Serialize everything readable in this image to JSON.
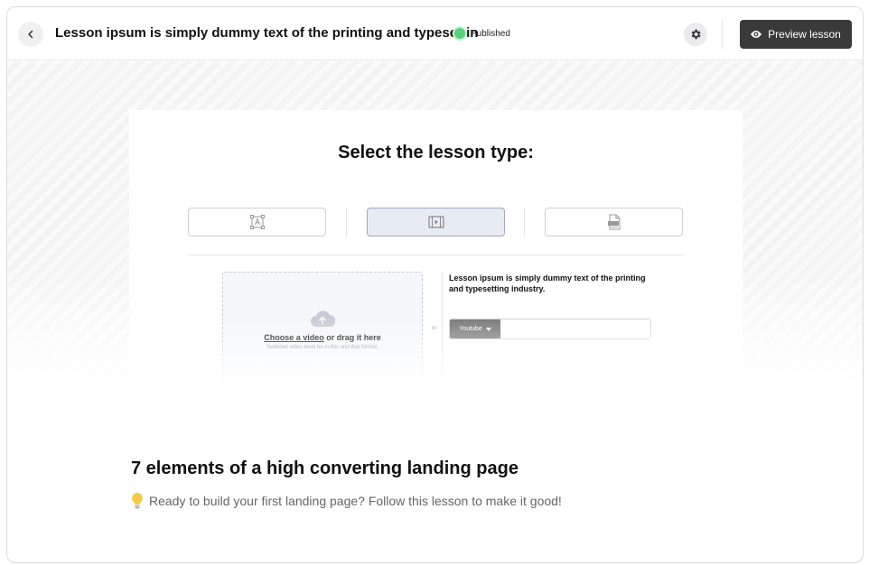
{
  "header": {
    "back_icon": "chevron-left-icon",
    "title": "Lesson ipsum is simply dummy text of the printing and typesettin",
    "status": "Published",
    "status_color": "#59d37a",
    "settings_icon": "gear-icon",
    "preview_label": "Preview lesson",
    "preview_icon": "eye-icon"
  },
  "lesson_type": {
    "title": "Select the lesson type:",
    "options": [
      {
        "icon": "text-lesson-icon",
        "active": false
      },
      {
        "icon": "video-lesson-icon",
        "active": true
      },
      {
        "icon": "pdf-lesson-icon",
        "active": false
      }
    ]
  },
  "upload": {
    "icon": "cloud-upload-icon",
    "choose_link": "Choose a video",
    "choose_rest": " or drag it here",
    "hint": "Selected video must be in this and that format.",
    "or": "or",
    "description": "Lesson ipsum is simply dummy text of the printing and typesetting industry.",
    "source_selected": "Youtube",
    "url_value": ""
  },
  "lesson": {
    "heading": "7 elements of a high converting landing page",
    "subtitle": "Ready to build your first landing page? Follow this lesson to make it good!",
    "subtitle_icon": "lightbulb-icon"
  },
  "colors": {
    "primary_button": "#3a3a3a",
    "active_option": "#e7ebf4"
  }
}
